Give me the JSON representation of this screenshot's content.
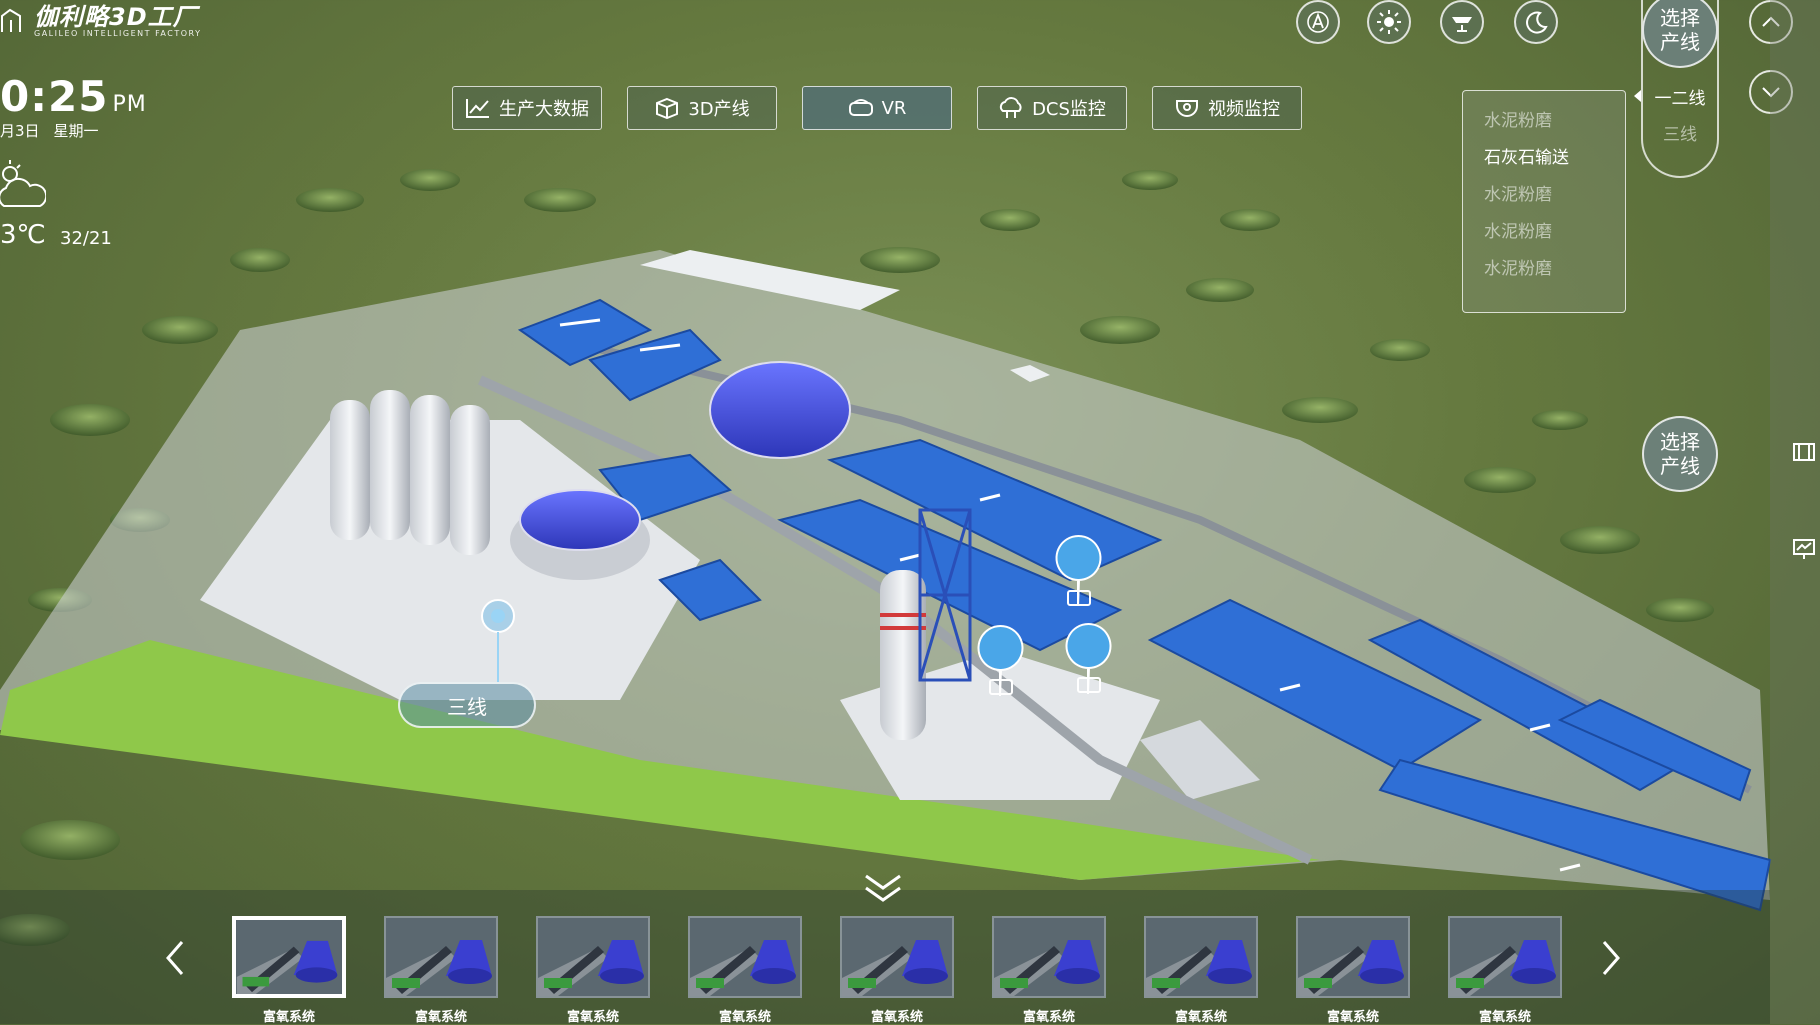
{
  "brand": {
    "title": "伽利略3D工厂",
    "subtitle": "GALILEO INTELLIGENT FACTORY"
  },
  "clock": {
    "time": "0:25",
    "ampm": "PM",
    "date": "月3日",
    "weekday": "星期一"
  },
  "weather": {
    "icon": "partly-cloudy-icon",
    "temp": "3℃",
    "range": "32/21"
  },
  "nav": [
    {
      "label": "生产大数据",
      "icon": "chart-icon"
    },
    {
      "label": "3D产线",
      "icon": "cube-icon"
    },
    {
      "label": "VR",
      "icon": "vr-headset-icon",
      "active": true
    },
    {
      "label": "DCS监控",
      "icon": "cloud-monitor-icon"
    },
    {
      "label": "视频监控",
      "icon": "camera-icon"
    }
  ],
  "modes": [
    "auto-icon",
    "sun-icon",
    "lamp-icon",
    "moon-icon"
  ],
  "line_select": {
    "label": "选择产线",
    "options": [
      "一二线",
      "三线"
    ],
    "selected": "一二线"
  },
  "dropdown": {
    "items": [
      "水泥粉磨",
      "石灰石输送",
      "水泥粉磨",
      "水泥粉磨",
      "水泥粉磨"
    ],
    "active_index": 1
  },
  "map_label": "三线",
  "gallery": {
    "items": [
      "富氧系统",
      "富氧系统",
      "富氧系统",
      "富氧系统",
      "富氧系统",
      "富氧系统",
      "富氧系统",
      "富氧系统",
      "富氧系统"
    ],
    "active_index": 0
  },
  "colors": {
    "roof_blue": "#2f6fd6",
    "grass": "#8fc84a",
    "ground": "#dfe3e6",
    "terrain": "#6b7f45"
  }
}
